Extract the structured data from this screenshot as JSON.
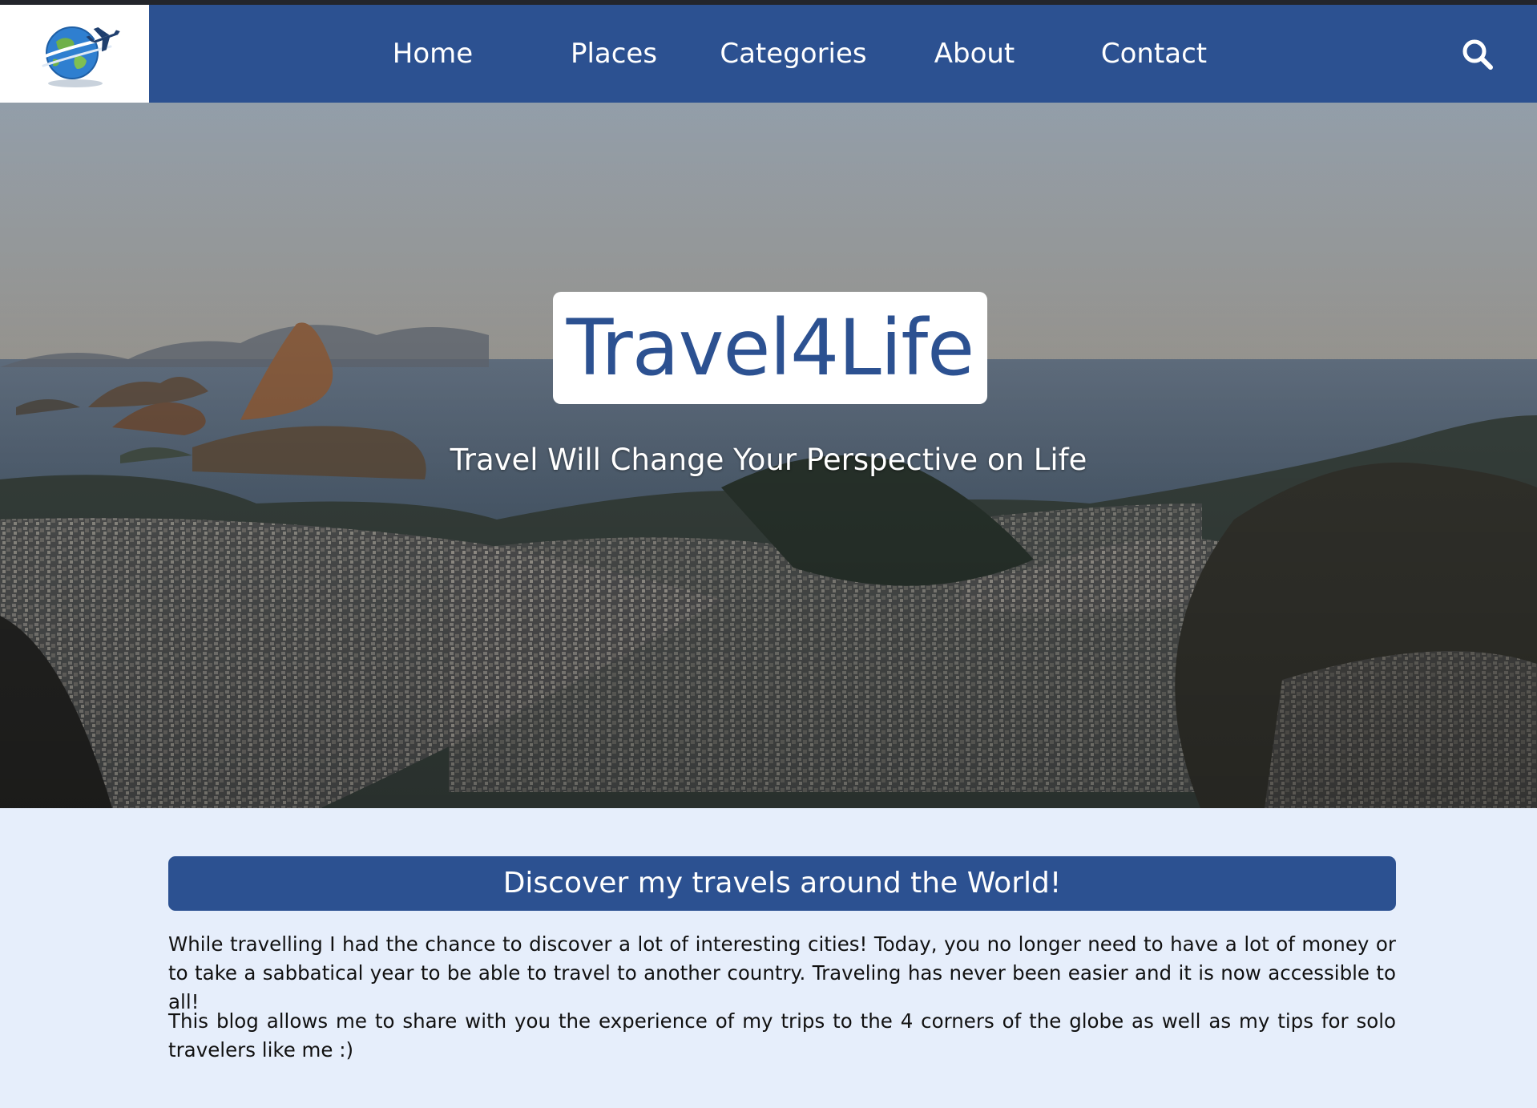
{
  "nav": {
    "items": [
      {
        "label": "Home"
      },
      {
        "label": "Places"
      },
      {
        "label": "Categories"
      },
      {
        "label": "About"
      },
      {
        "label": "Contact"
      }
    ],
    "search_icon": "search-icon",
    "logo_icon": "globe-airplane-logo"
  },
  "hero": {
    "title": "Travel4Life",
    "tagline": "Travel Will Change Your Perspective on Life"
  },
  "intro": {
    "heading": "Discover my travels around the World!",
    "paragraphs": [
      "While travelling I had the chance to discover a lot of interesting cities! Today, you no longer need to have a lot of money or to take a sabbatical year to be able to travel to another country. Traveling has never been easier and it is now accessible to all!",
      "This blog allows me to share with you the experience of my trips to the 4 corners of the globe as well as my tips for solo travelers like me :)"
    ]
  },
  "colors": {
    "brand_blue": "#2c5191",
    "content_bg": "#e6eefb",
    "white": "#ffffff"
  }
}
